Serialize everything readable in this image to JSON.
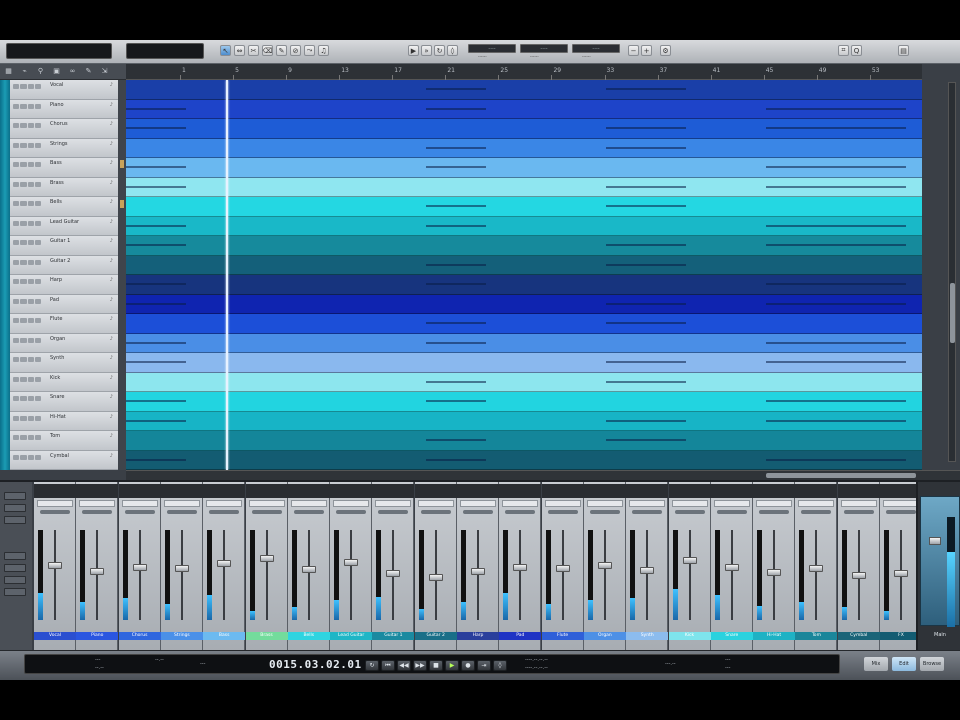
{
  "toolbar": {
    "tool_icons": [
      "arrow-icon",
      "range-icon",
      "split-icon",
      "eraser-icon",
      "pencil-icon",
      "mute-tool-icon",
      "bend-icon",
      "listen-icon"
    ],
    "time_fields": [
      {
        "value": "----",
        "label": "------"
      },
      {
        "value": "----",
        "label": "------"
      },
      {
        "value": "----",
        "label": "------"
      }
    ]
  },
  "tracks": [
    {
      "name": "Vocal",
      "color": "#1a3fa8",
      "type": "midi"
    },
    {
      "name": "Piano",
      "color": "#1e44c9",
      "type": "midi"
    },
    {
      "name": "Chorus",
      "color": "#1e5cd6",
      "type": "midi"
    },
    {
      "name": "Strings",
      "color": "#3a86e6",
      "type": "midi"
    },
    {
      "name": "Bass",
      "color": "#6ab8f0",
      "type": "midi"
    },
    {
      "name": "Brass",
      "color": "#8fe6f0",
      "type": "midi"
    },
    {
      "name": "Bells",
      "color": "#24d7e2",
      "type": "midi"
    },
    {
      "name": "Lead Guitar",
      "color": "#19b8c8",
      "type": "midi"
    },
    {
      "name": "Guitar 1",
      "color": "#168a9c",
      "type": "midi"
    },
    {
      "name": "Guitar 2",
      "color": "#14607a",
      "type": "midi"
    },
    {
      "name": "Harp",
      "color": "#17347e",
      "type": "midi"
    },
    {
      "name": "Pad",
      "color": "#0f24b0",
      "type": "midi"
    },
    {
      "name": "Flute",
      "color": "#1c4fd8",
      "type": "midi"
    },
    {
      "name": "Organ",
      "color": "#4a8ee6",
      "type": "midi"
    },
    {
      "name": "Synth",
      "color": "#8ab8ee",
      "type": "midi"
    },
    {
      "name": "Kick",
      "color": "#8de6ee",
      "type": "midi"
    },
    {
      "name": "Snare",
      "color": "#22d4e0",
      "type": "midi"
    },
    {
      "name": "Hi-Hat",
      "color": "#17b4c6",
      "type": "midi"
    },
    {
      "name": "Tom",
      "color": "#14869a",
      "type": "midi"
    },
    {
      "name": "Cymbal",
      "color": "#135c72",
      "type": "midi"
    }
  ],
  "ruler": {
    "bars": [
      "1",
      "5",
      "9",
      "13",
      "17",
      "21",
      "25",
      "29",
      "33",
      "37",
      "41",
      "45",
      "49",
      "53",
      "57"
    ]
  },
  "playhead_bar": 8,
  "mixer": {
    "channels": [
      {
        "label": "Vocal",
        "color": "#2a4fd0",
        "fader": 0.62,
        "meter": 0.3
      },
      {
        "label": "Piano",
        "color": "#2a56e0",
        "fader": 0.55,
        "meter": 0.2
      },
      {
        "label": "Chorus",
        "color": "#2f66de",
        "fader": 0.6,
        "meter": 0.25
      },
      {
        "label": "Strings",
        "color": "#4a90e8",
        "fader": 0.58,
        "meter": 0.18
      },
      {
        "label": "Bass",
        "color": "#6cbaf0",
        "fader": 0.64,
        "meter": 0.28
      },
      {
        "label": "Brass",
        "color": "#73dc9c",
        "fader": 0.7,
        "meter": 0.1
      },
      {
        "label": "Bells",
        "color": "#2fd4e0",
        "fader": 0.57,
        "meter": 0.15
      },
      {
        "label": "Lead Guitar",
        "color": "#1fb6c6",
        "fader": 0.66,
        "meter": 0.22
      },
      {
        "label": "Guitar 1",
        "color": "#1a8aa0",
        "fader": 0.52,
        "meter": 0.26
      },
      {
        "label": "Guitar 2",
        "color": "#1a6f88",
        "fader": 0.48,
        "meter": 0.12
      },
      {
        "label": "Harp",
        "color": "#2a3f9c",
        "fader": 0.55,
        "meter": 0.2
      },
      {
        "label": "Pad",
        "color": "#1f33c4",
        "fader": 0.6,
        "meter": 0.3
      },
      {
        "label": "Flute",
        "color": "#2f5fd8",
        "fader": 0.58,
        "meter": 0.18
      },
      {
        "label": "Organ",
        "color": "#4d90e6",
        "fader": 0.62,
        "meter": 0.22
      },
      {
        "label": "Synth",
        "color": "#8cbcee",
        "fader": 0.56,
        "meter": 0.24
      },
      {
        "label": "Kick",
        "color": "#7ee4ec",
        "fader": 0.68,
        "meter": 0.35
      },
      {
        "label": "Snare",
        "color": "#2ad2de",
        "fader": 0.6,
        "meter": 0.28
      },
      {
        "label": "Hi-Hat",
        "color": "#1eb2c4",
        "fader": 0.54,
        "meter": 0.16
      },
      {
        "label": "Tom",
        "color": "#1a869a",
        "fader": 0.58,
        "meter": 0.2
      },
      {
        "label": "Cymbal",
        "color": "#1a6478",
        "fader": 0.5,
        "meter": 0.14
      },
      {
        "label": "FX",
        "color": "#135c72",
        "fader": 0.52,
        "meter": 0.1
      }
    ],
    "master_label": "Main"
  },
  "transport": {
    "time_display": "0015.03.02.01",
    "lcd_left_1": "---",
    "lcd_left_2": "--.--",
    "lcd_left_3": "--.--",
    "lcd_left_4": "---",
    "tempo_block": "---.--",
    "loop_start": "----.--.--.--",
    "loop_end": "----.--.--.--",
    "right_1": "---",
    "right_2": "---",
    "view_buttons": [
      "Mix",
      "Edit",
      "Browse"
    ]
  }
}
